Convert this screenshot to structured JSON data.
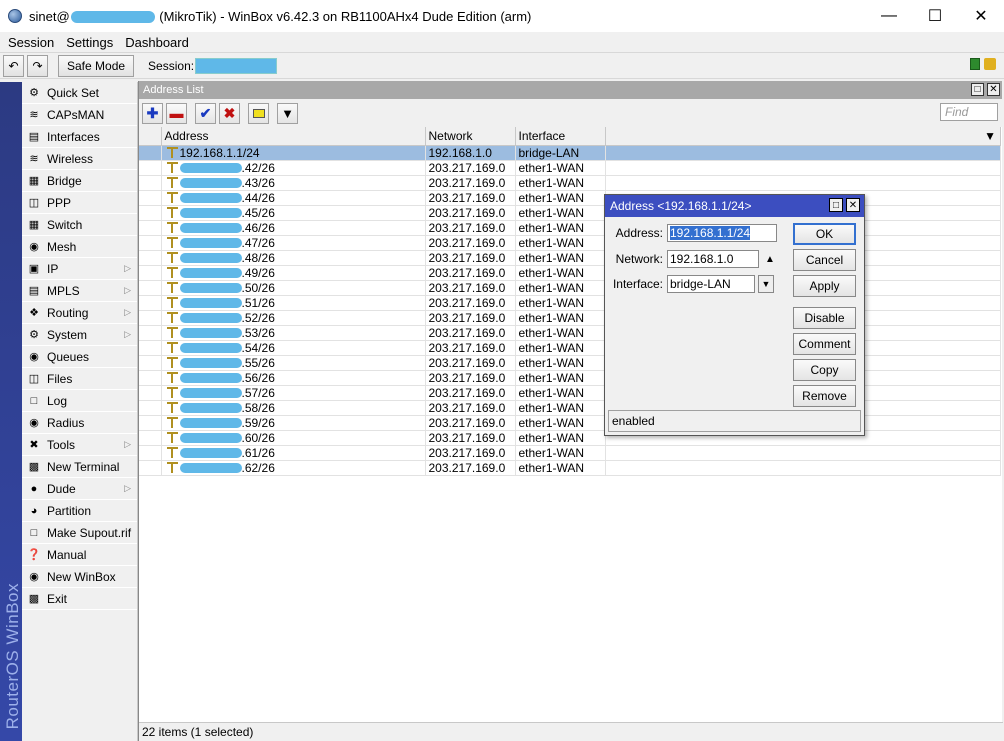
{
  "window": {
    "title_prefix": "sinet@",
    "title_suffix": "(MikroTik) - WinBox v6.42.3 on RB1100AHx4 Dude Edition (arm)"
  },
  "menu": [
    "Session",
    "Settings",
    "Dashboard"
  ],
  "toolbar": {
    "safe_mode": "Safe Mode",
    "session_label": "Session:"
  },
  "brand": "RouterOS WinBox",
  "sidebar": {
    "items": [
      {
        "label": "Quick Set",
        "icon": "quick-set-icon",
        "arrow": false
      },
      {
        "label": "CAPsMAN",
        "icon": "capsman-icon",
        "arrow": false
      },
      {
        "label": "Interfaces",
        "icon": "interfaces-icon",
        "arrow": false
      },
      {
        "label": "Wireless",
        "icon": "wireless-icon",
        "arrow": false
      },
      {
        "label": "Bridge",
        "icon": "bridge-icon",
        "arrow": false
      },
      {
        "label": "PPP",
        "icon": "ppp-icon",
        "arrow": false
      },
      {
        "label": "Switch",
        "icon": "switch-icon",
        "arrow": false
      },
      {
        "label": "Mesh",
        "icon": "mesh-icon",
        "arrow": false
      },
      {
        "label": "IP",
        "icon": "ip-icon",
        "arrow": true
      },
      {
        "label": "MPLS",
        "icon": "mpls-icon",
        "arrow": true
      },
      {
        "label": "Routing",
        "icon": "routing-icon",
        "arrow": true
      },
      {
        "label": "System",
        "icon": "system-icon",
        "arrow": true
      },
      {
        "label": "Queues",
        "icon": "queues-icon",
        "arrow": false
      },
      {
        "label": "Files",
        "icon": "files-icon",
        "arrow": false
      },
      {
        "label": "Log",
        "icon": "log-icon",
        "arrow": false
      },
      {
        "label": "Radius",
        "icon": "radius-icon",
        "arrow": false
      },
      {
        "label": "Tools",
        "icon": "tools-icon",
        "arrow": true
      },
      {
        "label": "New Terminal",
        "icon": "terminal-icon",
        "arrow": false
      },
      {
        "label": "Dude",
        "icon": "dude-icon",
        "arrow": true
      },
      {
        "label": "Partition",
        "icon": "partition-icon",
        "arrow": false
      },
      {
        "label": "Make Supout.rif",
        "icon": "supout-icon",
        "arrow": false
      },
      {
        "label": "Manual",
        "icon": "manual-icon",
        "arrow": false
      },
      {
        "label": "New WinBox",
        "icon": "winbox-icon",
        "arrow": false
      },
      {
        "label": "Exit",
        "icon": "exit-icon",
        "arrow": false
      }
    ]
  },
  "address_list": {
    "title": "Address List",
    "find_placeholder": "Find",
    "columns": [
      "Address",
      "Network",
      "Interface"
    ],
    "rows": [
      {
        "address": "192.168.1.1/24",
        "address_suffix": "",
        "network": "192.168.1.0",
        "interface": "bridge-LAN",
        "selected": true
      },
      {
        "address": "",
        "address_suffix": ".42/26",
        "network": "203.217.169.0",
        "interface": "ether1-WAN"
      },
      {
        "address": "",
        "address_suffix": ".43/26",
        "network": "203.217.169.0",
        "interface": "ether1-WAN"
      },
      {
        "address": "",
        "address_suffix": ".44/26",
        "network": "203.217.169.0",
        "interface": "ether1-WAN"
      },
      {
        "address": "",
        "address_suffix": ".45/26",
        "network": "203.217.169.0",
        "interface": "ether1-WAN"
      },
      {
        "address": "",
        "address_suffix": ".46/26",
        "network": "203.217.169.0",
        "interface": "ether1-WAN"
      },
      {
        "address": "",
        "address_suffix": ".47/26",
        "network": "203.217.169.0",
        "interface": "ether1-WAN"
      },
      {
        "address": "",
        "address_suffix": ".48/26",
        "network": "203.217.169.0",
        "interface": "ether1-WAN"
      },
      {
        "address": "",
        "address_suffix": ".49/26",
        "network": "203.217.169.0",
        "interface": "ether1-WAN"
      },
      {
        "address": "",
        "address_suffix": ".50/26",
        "network": "203.217.169.0",
        "interface": "ether1-WAN"
      },
      {
        "address": "",
        "address_suffix": ".51/26",
        "network": "203.217.169.0",
        "interface": "ether1-WAN"
      },
      {
        "address": "",
        "address_suffix": ".52/26",
        "network": "203.217.169.0",
        "interface": "ether1-WAN"
      },
      {
        "address": "",
        "address_suffix": ".53/26",
        "network": "203.217.169.0",
        "interface": "ether1-WAN"
      },
      {
        "address": "",
        "address_suffix": ".54/26",
        "network": "203.217.169.0",
        "interface": "ether1-WAN"
      },
      {
        "address": "",
        "address_suffix": ".55/26",
        "network": "203.217.169.0",
        "interface": "ether1-WAN"
      },
      {
        "address": "",
        "address_suffix": ".56/26",
        "network": "203.217.169.0",
        "interface": "ether1-WAN"
      },
      {
        "address": "",
        "address_suffix": ".57/26",
        "network": "203.217.169.0",
        "interface": "ether1-WAN"
      },
      {
        "address": "",
        "address_suffix": ".58/26",
        "network": "203.217.169.0",
        "interface": "ether1-WAN"
      },
      {
        "address": "",
        "address_suffix": ".59/26",
        "network": "203.217.169.0",
        "interface": "ether1-WAN"
      },
      {
        "address": "",
        "address_suffix": ".60/26",
        "network": "203.217.169.0",
        "interface": "ether1-WAN"
      },
      {
        "address": "",
        "address_suffix": ".61/26",
        "network": "203.217.169.0",
        "interface": "ether1-WAN"
      },
      {
        "address": "",
        "address_suffix": ".62/26",
        "network": "203.217.169.0",
        "interface": "ether1-WAN"
      }
    ],
    "status": "22 items (1 selected)"
  },
  "dialog": {
    "title": "Address <192.168.1.1/24>",
    "address_label": "Address:",
    "address_value": "192.168.1.1/24",
    "network_label": "Network:",
    "network_value": "192.168.1.0",
    "interface_label": "Interface:",
    "interface_value": "bridge-LAN",
    "buttons": [
      "OK",
      "Cancel",
      "Apply",
      "Disable",
      "Comment",
      "Copy",
      "Remove"
    ],
    "status": "enabled"
  },
  "colors": {
    "selected_row": "#9cbce0",
    "dialog_header": "#3c4ec0",
    "brand_bar": "#2c3a82"
  }
}
